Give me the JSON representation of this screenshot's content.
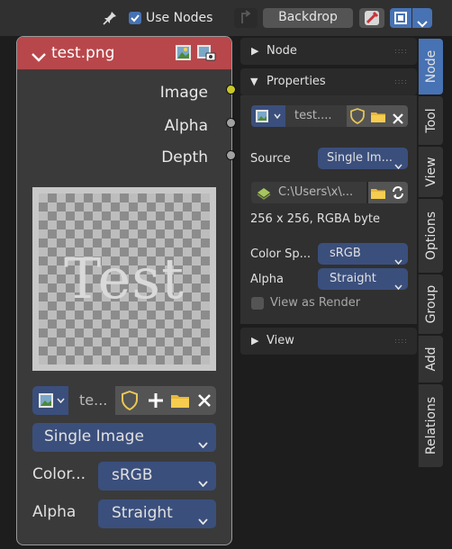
{
  "header": {
    "use_nodes_label": "Use Nodes",
    "use_nodes_checked": true,
    "backdrop_label": "Backdrop"
  },
  "node": {
    "title": "test.png",
    "outputs": [
      "Image",
      "Alpha",
      "Depth"
    ],
    "preview_text": "Test",
    "image_name": "te...",
    "source_value": "Single Image",
    "color_label": "Color...",
    "color_value": "sRGB",
    "alpha_label": "Alpha",
    "alpha_value": "Straight"
  },
  "panel": {
    "node_section": "Node",
    "properties_section": "Properties",
    "image_name": "test....",
    "source_label": "Source",
    "source_value": "Single Im...",
    "filepath": "C:\\Users\\x\\...",
    "info": "256 x 256,  RGBA byte",
    "color_space_label": "Color Sp...",
    "color_space_value": "sRGB",
    "alpha_label": "Alpha",
    "alpha_value": "Straight",
    "view_as_render_label": "View as Render",
    "view_section": "View"
  },
  "tabs": [
    "Node",
    "Tool",
    "View",
    "Options",
    "Group",
    "Add",
    "Relations"
  ],
  "colors": {
    "node_header": "#b8474b",
    "socket_image": "#c7c729",
    "socket_gray": "#a1a1a1",
    "accent_blue": "#4772b3",
    "folder_yellow": "#e8b83a"
  }
}
